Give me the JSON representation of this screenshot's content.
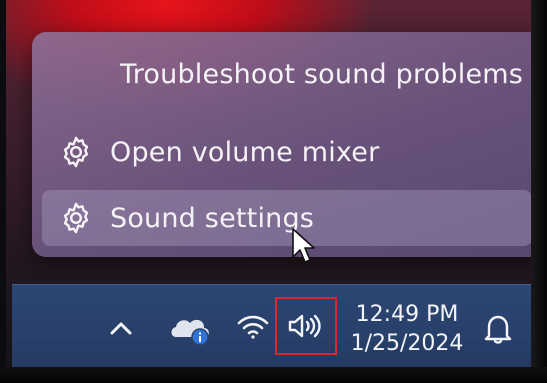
{
  "context_menu": {
    "items": [
      {
        "label": "Troubleshoot sound problems",
        "icon": null
      },
      {
        "label": "Open volume mixer",
        "icon": "gear-icon"
      },
      {
        "label": "Sound settings",
        "icon": "gear-icon",
        "state": "hovered"
      }
    ]
  },
  "taskbar": {
    "tray_icons": [
      "chevron-up-icon",
      "onedrive-icon",
      "wifi-icon",
      "volume-icon"
    ],
    "clock": {
      "time": "12:49 PM",
      "date": "1/25/2024"
    },
    "notification_icon": "bell-icon"
  },
  "colors": {
    "menu_background": "#7a6690",
    "menu_text": "#f6f3f8",
    "hover_highlight": "#b0a4c6",
    "taskbar_background": "#2a426c",
    "volume_highlight_box": "#e0262a",
    "onedrive_badge": "#2e74d8"
  }
}
